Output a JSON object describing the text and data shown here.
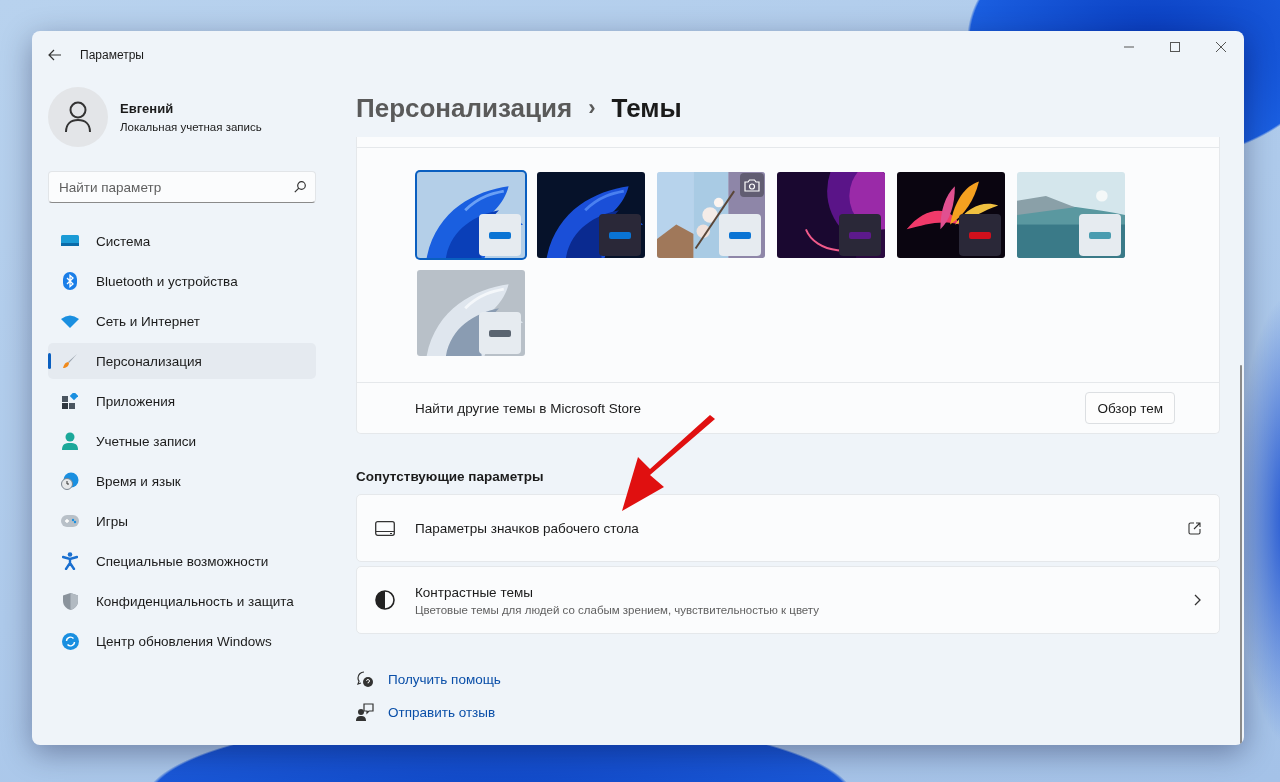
{
  "window": {
    "title": "Параметры"
  },
  "user": {
    "name": "Евгений",
    "account": "Локальная учетная запись"
  },
  "search": {
    "placeholder": "Найти параметр"
  },
  "sidebar": {
    "items": [
      {
        "label": "Система",
        "selected": false
      },
      {
        "label": "Bluetooth и устройства",
        "selected": false
      },
      {
        "label": "Сеть и Интернет",
        "selected": false
      },
      {
        "label": "Персонализация",
        "selected": true
      },
      {
        "label": "Приложения",
        "selected": false
      },
      {
        "label": "Учетные записи",
        "selected": false
      },
      {
        "label": "Время и язык",
        "selected": false
      },
      {
        "label": "Игры",
        "selected": false
      },
      {
        "label": "Специальные возможности",
        "selected": false
      },
      {
        "label": "Конфиденциальность и защита",
        "selected": false
      },
      {
        "label": "Центр обновления Windows",
        "selected": false
      }
    ]
  },
  "breadcrumb": {
    "parent": "Персонализация",
    "separator": "›",
    "current": "Темы"
  },
  "themes": [
    {
      "color": "#0a74d4",
      "selected": true
    },
    {
      "color": "#0a74d4",
      "selected": false
    },
    {
      "color": "#0a74d4",
      "selected": false
    },
    {
      "color": "#5c1a8c",
      "selected": false
    },
    {
      "color": "#d0101c",
      "selected": false
    },
    {
      "color": "#4a9cb0",
      "selected": false
    },
    {
      "color": "#5a6470",
      "selected": false
    }
  ],
  "store": {
    "text": "Найти другие темы в Microsoft Store",
    "button": "Обзор тем"
  },
  "related": {
    "heading": "Сопутствующие параметры",
    "items": [
      {
        "kind": "external",
        "title": "Параметры значков рабочего стола"
      },
      {
        "kind": "navigate",
        "title": "Контрастные темы",
        "subtitle": "Цветовые темы для людей со слабым зрением, чувствительностью к цвету"
      }
    ]
  },
  "links": [
    {
      "label": "Получить помощь"
    },
    {
      "label": "Отправить отзыв"
    }
  ]
}
